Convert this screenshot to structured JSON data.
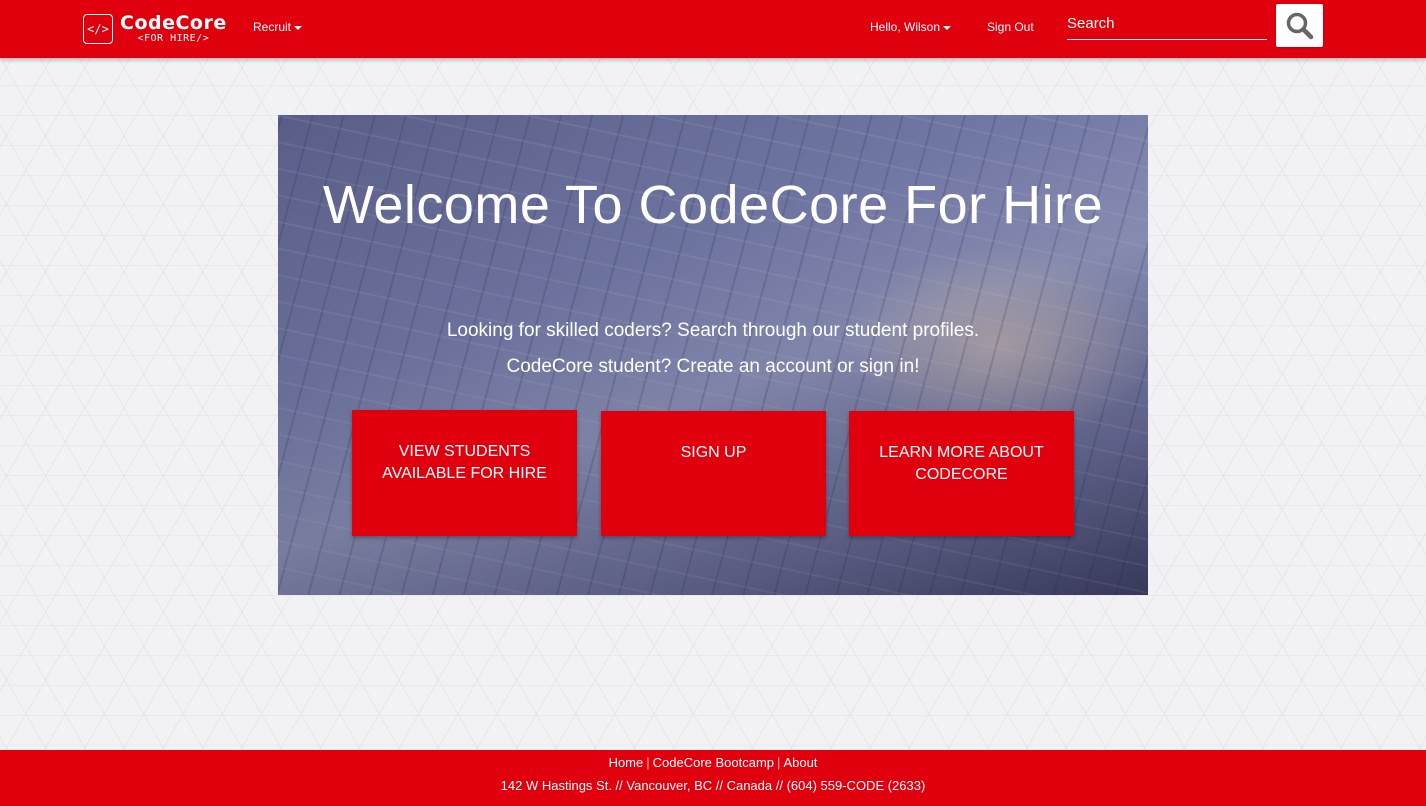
{
  "header": {
    "logo": {
      "title": "CodeCore",
      "subtitle": "<FOR HIRE/>",
      "mark": "</>"
    },
    "nav": {
      "recruit_label": "Recruit"
    },
    "user": {
      "greeting": "Hello, Wilson",
      "sign_out_label": "Sign Out"
    },
    "search": {
      "placeholder": "Search",
      "icon": "search-icon"
    }
  },
  "hero": {
    "title": "Welcome To CodeCore For Hire",
    "line1": "Looking for skilled coders? Search through our student profiles.",
    "line2": "CodeCore student? Create an account or sign in!",
    "buttons": [
      {
        "label": "View Students Available For Hire"
      },
      {
        "label": "Sign Up"
      },
      {
        "label": "Learn More About CodeCore"
      }
    ]
  },
  "footer": {
    "links": [
      {
        "label": "Home"
      },
      {
        "label": "CodeCore Bootcamp"
      },
      {
        "label": "About"
      }
    ],
    "address": "142 W Hastings St. // Vancouver, BC // Canada // (604) 559-CODE (2633)"
  },
  "colors": {
    "brand": "#e0000d",
    "text_on_brand": "#ffffff"
  }
}
